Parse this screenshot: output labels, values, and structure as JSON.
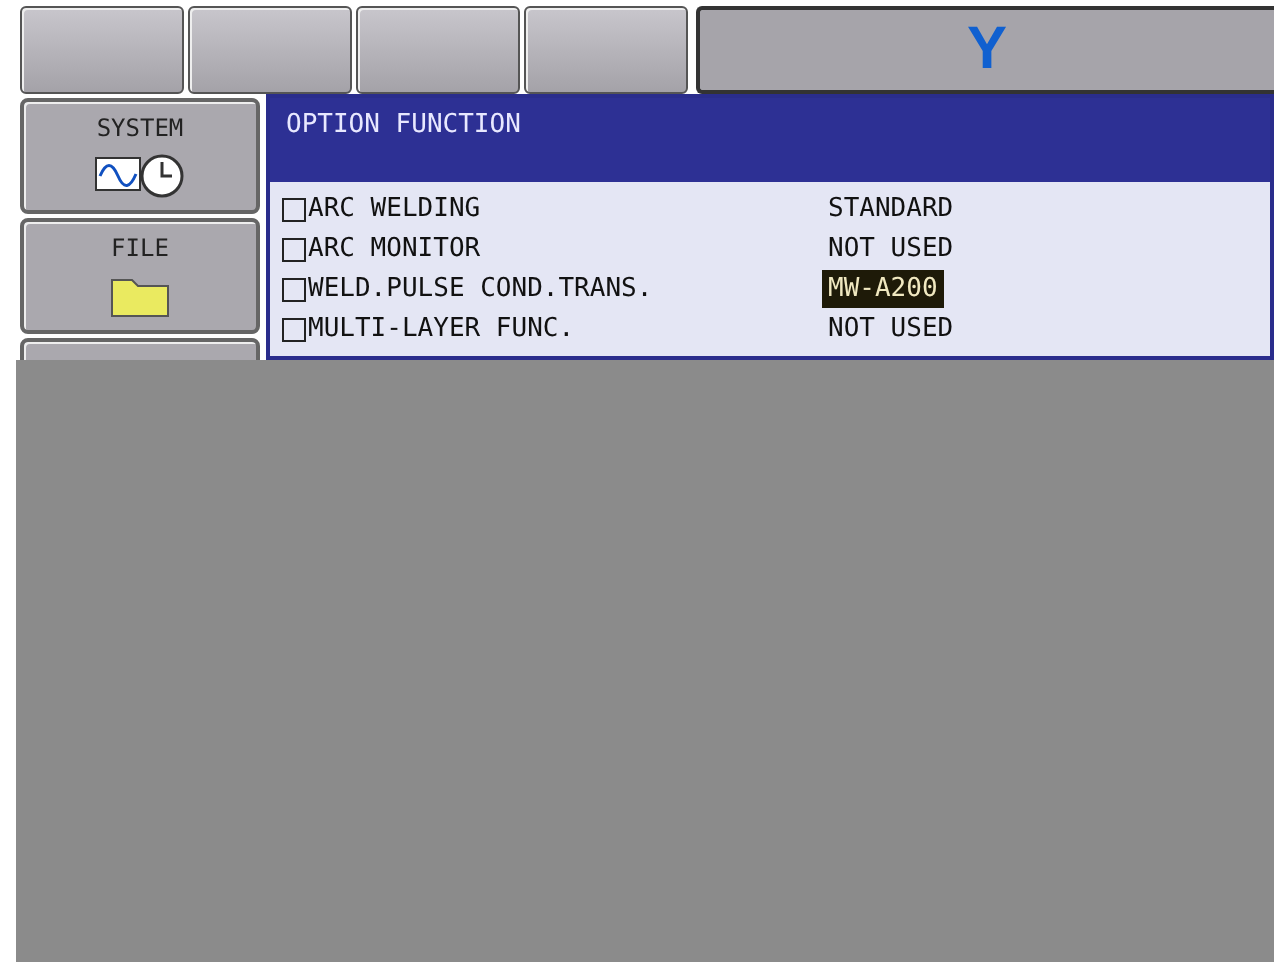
{
  "top_bar": {
    "buttons": [
      {
        "kind": "blank"
      },
      {
        "kind": "blank"
      },
      {
        "kind": "blank"
      },
      {
        "kind": "blank"
      }
    ],
    "logo": "Y"
  },
  "main_menu": [
    {
      "label": "SYSTEM",
      "kind": "system"
    },
    {
      "label": "FILE",
      "kind": "file"
    },
    {
      "kind": "blank"
    }
  ],
  "panel": {
    "title": "OPTION FUNCTION",
    "rows": [
      {
        "name": "ARC WELDING",
        "value": "STANDARD",
        "selected": false
      },
      {
        "name": "ARC MONITOR",
        "value": "NOT USED",
        "selected": false
      },
      {
        "name": "WELD.PULSE COND.TRANS.",
        "value": "MW-A200",
        "selected": true
      },
      {
        "name": "MULTI-LAYER FUNC.",
        "value": "NOT USED",
        "selected": false
      }
    ]
  }
}
